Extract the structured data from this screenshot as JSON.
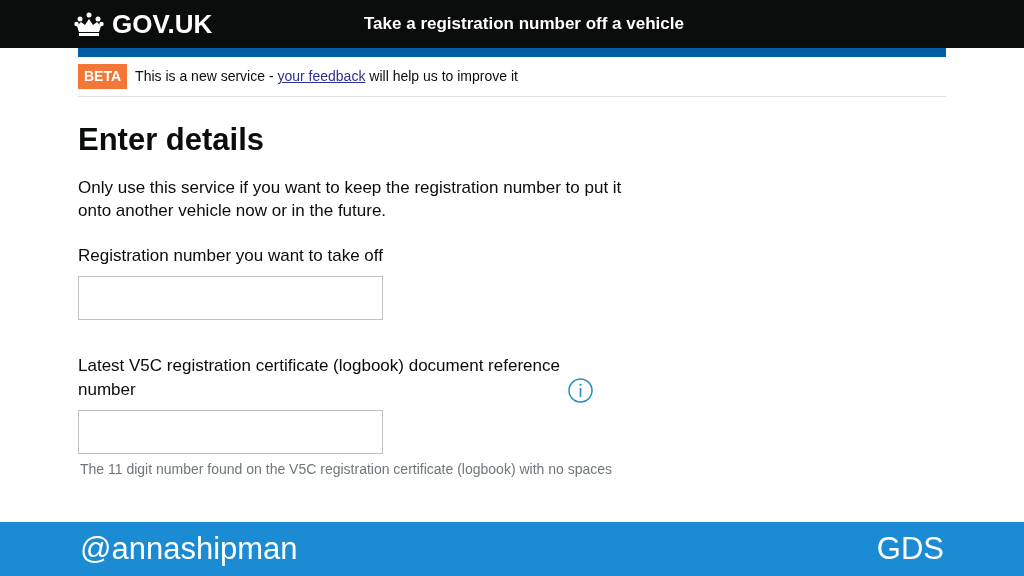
{
  "header": {
    "logo": "GOV.UK",
    "service_name": "Take a registration number off a vehicle"
  },
  "beta_banner": {
    "tag": "BETA",
    "text_before": "This is a new service -",
    "link": "your feedback",
    "text_after": "will help us to improve it"
  },
  "heading": "Enter details",
  "intro": "Only use this service if you want to keep the registration number to put it onto another vehicle now or in the future.",
  "fields": [
    {
      "label": "Registration number you want to take off",
      "info": false
    },
    {
      "label": "Latest V5C registration certificate (logbook) document reference number",
      "info": true,
      "hint": "The 11 digit number found on the V5C registration certificate (logbook) with no spaces"
    }
  ],
  "footer": {
    "handle": "@annashipman",
    "org": "GDS"
  }
}
